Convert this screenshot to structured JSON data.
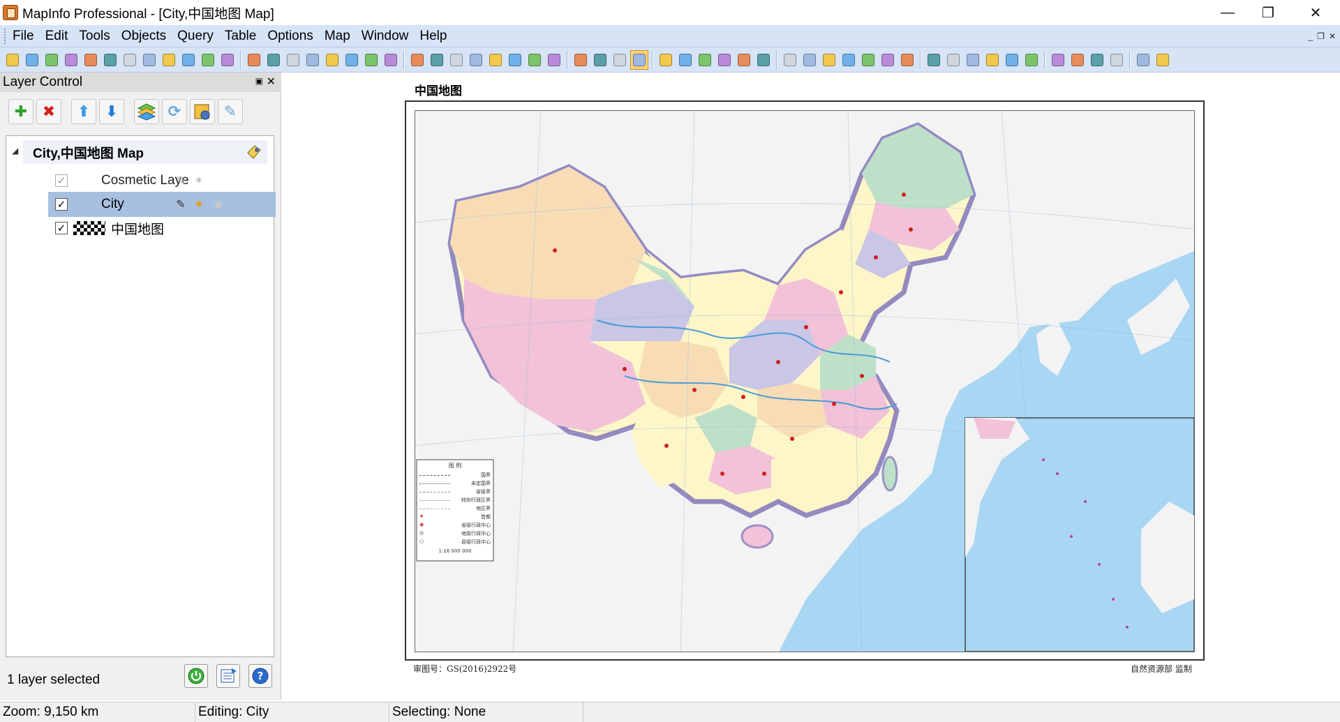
{
  "window": {
    "title": "MapInfo Professional - [City,中国地图 Map]",
    "controls": {
      "minimize": "—",
      "restore": "❐",
      "close": "✕"
    }
  },
  "menu": {
    "items": [
      "File",
      "Edit",
      "Tools",
      "Objects",
      "Query",
      "Table",
      "Options",
      "Map",
      "Window",
      "Help"
    ],
    "mdi_controls": [
      "_",
      "❐",
      "✕"
    ]
  },
  "toolbar": {
    "icons": [
      "new-icon",
      "open-icon",
      "open-workspace-icon",
      "close-icon",
      "close-all-icon",
      "save-copy-icon",
      "save-workspace-icon",
      "save-icon",
      "save-as-icon",
      "open-folder-icon",
      "print-preview-icon",
      "print-icon",
      "draw-object-icon",
      "line-icon",
      "polyline-icon",
      "arc-icon",
      "polygon-icon",
      "ellipse-icon",
      "rectangle-icon",
      "rounded-rect-icon",
      "select-icon",
      "marquee-select-icon",
      "radius-select-icon",
      "polygon-select-icon",
      "boundary-select-icon",
      "unselect-icon",
      "invert-select-icon",
      "graph-select-icon",
      "zoom-in-icon",
      "zoom-out-icon",
      "change-view-icon",
      "pan-icon",
      "info-icon",
      "ruler-icon",
      "label-icon",
      "drag-window-icon",
      "layer-control-icon",
      "measure-icon",
      "legend-icon",
      "statistics-icon",
      "clip-region-icon",
      "reshape-icon",
      "add-node-icon",
      "show-hide-icon",
      "scale-bar-icon",
      "map-window-icon",
      "globe-icon",
      "thematic-icon",
      "graph-icon",
      "3d-icon",
      "geocode-icon",
      "layout-icon",
      "browser-icon",
      "redistrict-icon",
      "table-icon",
      "catalog-icon",
      "tool-manager-icon"
    ],
    "active_tool": "pan-icon"
  },
  "layer_control": {
    "title": "Layer Control",
    "pin": "📌",
    "close": "✕",
    "tools": [
      "add-layer-icon",
      "remove-layer-icon",
      "move-up-icon",
      "move-down-icon",
      "layer-properties-icon",
      "refresh-icon",
      "layer-options-icon",
      "edit-layers-icon"
    ],
    "map_node": {
      "label": "City,中国地图 Map",
      "expanded": true
    },
    "layers": [
      {
        "name": "Cosmetic Laye",
        "visible": true,
        "dimmed": true,
        "selected": false
      },
      {
        "name": "City",
        "visible": true,
        "dimmed": false,
        "selected": true
      },
      {
        "name": "中国地图",
        "visible": true,
        "dimmed": false,
        "selected": false
      }
    ],
    "status": "1 layer selected"
  },
  "map": {
    "title": "中国地图",
    "foot_left": "审图号：GS(2016)2922号",
    "foot_right": "自然资源部 监制",
    "legend": {
      "title": "图  例",
      "rows": [
        "国界",
        "未定国界",
        "省级界",
        "特别行政区界",
        "地区界",
        "首都",
        "省级行政中心",
        "地级行政中心",
        "县级行政中心"
      ],
      "scale": "1:16 000 000"
    },
    "colors": {
      "sea": "#a9d6f2",
      "land_outside": "#f3f3f3",
      "border": "#7b6fb8"
    }
  },
  "statusbar": {
    "zoom": "Zoom: 9,150 km",
    "editing": "Editing: City",
    "selecting": "Selecting: None"
  }
}
